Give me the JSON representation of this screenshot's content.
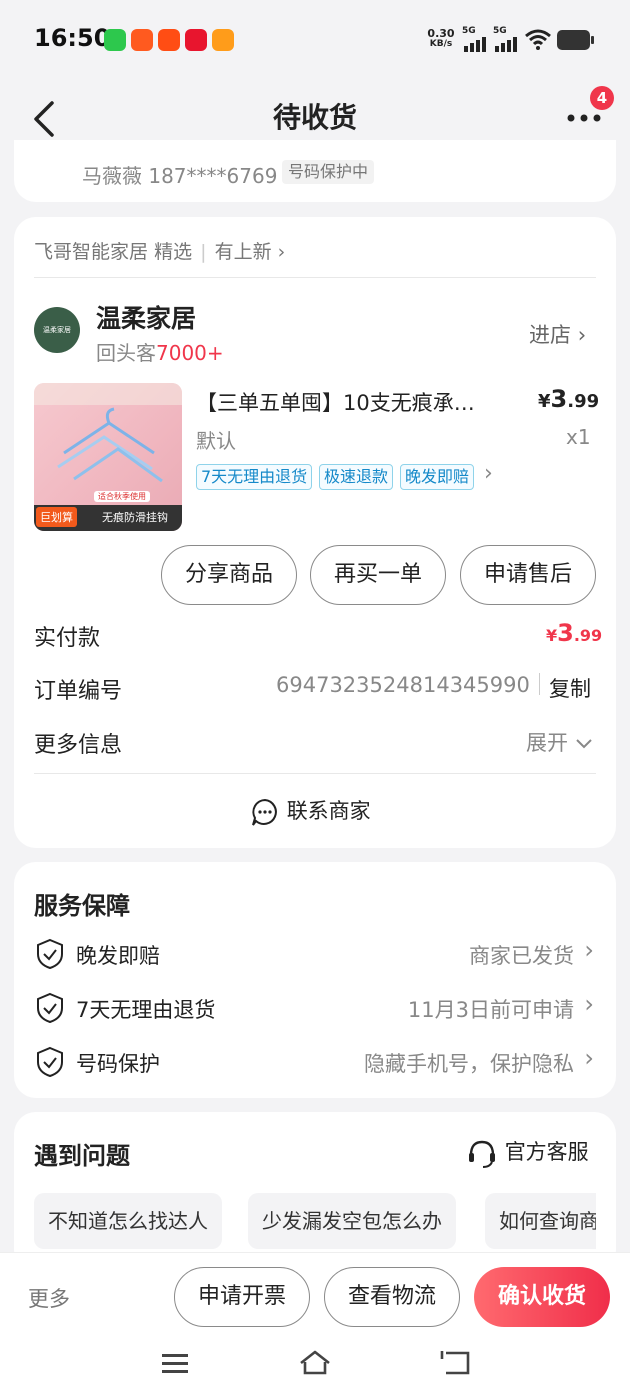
{
  "status_bar": {
    "time": "16:50",
    "net_speed_value": "0.30",
    "net_speed_unit": "KB/s",
    "signal1": "5G",
    "signal2": "5G"
  },
  "header": {
    "title": "待收货",
    "badge_count": "4"
  },
  "address": {
    "contact": "马薇薇 187****6769",
    "privacy_tag": "号码保护中"
  },
  "order": {
    "shop_path": "飞哥智能家居",
    "shop_path_tag": "精选",
    "new_arrivals": "有上新",
    "store_name": "温柔家居",
    "store_logo_text": "温柔家居",
    "store_returning_label": "回头客",
    "store_returning_count": "7000+",
    "enter_store": "进店",
    "product_title": "【三单五单囤】10支无痕承…",
    "price_symbol": "¥",
    "price_int": "3",
    "price_dec": ".99",
    "variant": "默认",
    "quantity": "x1",
    "product_badge": "巨划算",
    "product_banner": "无痕防滑挂钩",
    "product_sub_banner": "适合秋季使用",
    "tags": [
      "7天无理由退货",
      "极速退款",
      "晚发即赔"
    ],
    "buttons": [
      "分享商品",
      "再买一单",
      "申请售后"
    ],
    "paid_label": "实付款",
    "paid_symbol": "¥",
    "paid_int": "3",
    "paid_dec": ".99",
    "order_no_label": "订单编号",
    "order_no": "6947323524814345990",
    "copy_label": "复制",
    "more_info_label": "更多信息",
    "expand_label": "展开",
    "contact_merchant": "联系商家"
  },
  "service": {
    "title": "服务保障",
    "items": [
      {
        "label": "晚发即赔",
        "value": "商家已发货"
      },
      {
        "label": "7天无理由退货",
        "value": "11月3日前可申请"
      },
      {
        "label": "号码保护",
        "value": "隐藏手机号，保护隐私"
      }
    ]
  },
  "problems": {
    "title": "遇到问题",
    "official_service": "官方客服",
    "chips": [
      "不知道怎么找达人",
      "少发漏发空包怎么办",
      "如何查询商"
    ]
  },
  "bottom_bar": {
    "more": "更多",
    "invoice": "申请开票",
    "logistics": "查看物流",
    "confirm": "确认收货"
  },
  "colors": {
    "accent_red": "#f0364b",
    "tag_blue": "#1589c9",
    "confirm_gradient_start": "#ff6a6f",
    "confirm_gradient_end": "#f02e4a"
  }
}
